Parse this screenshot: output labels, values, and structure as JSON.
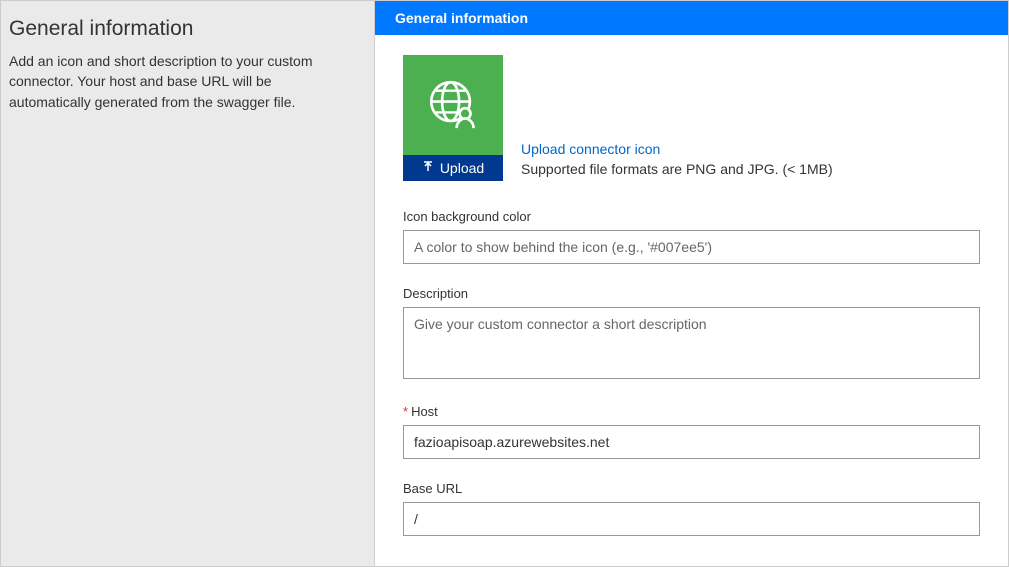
{
  "sidebar": {
    "title": "General information",
    "description": "Add an icon and short description to your custom connector. Your host and base URL will be automatically generated from the swagger file."
  },
  "header": {
    "title": "General information"
  },
  "iconSection": {
    "uploadLabel": "Upload",
    "linkText": "Upload connector icon",
    "supportedText": "Supported file formats are PNG and JPG. (< 1MB)",
    "iconBg": "#4caf50"
  },
  "fields": {
    "iconBgColor": {
      "label": "Icon background color",
      "placeholder": "A color to show behind the icon (e.g., '#007ee5')",
      "value": ""
    },
    "description": {
      "label": "Description",
      "placeholder": "Give your custom connector a short description",
      "value": ""
    },
    "host": {
      "label": "Host",
      "required": "*",
      "value": "fazioapisoap.azurewebsites.net"
    },
    "baseUrl": {
      "label": "Base URL",
      "value": "/"
    }
  }
}
